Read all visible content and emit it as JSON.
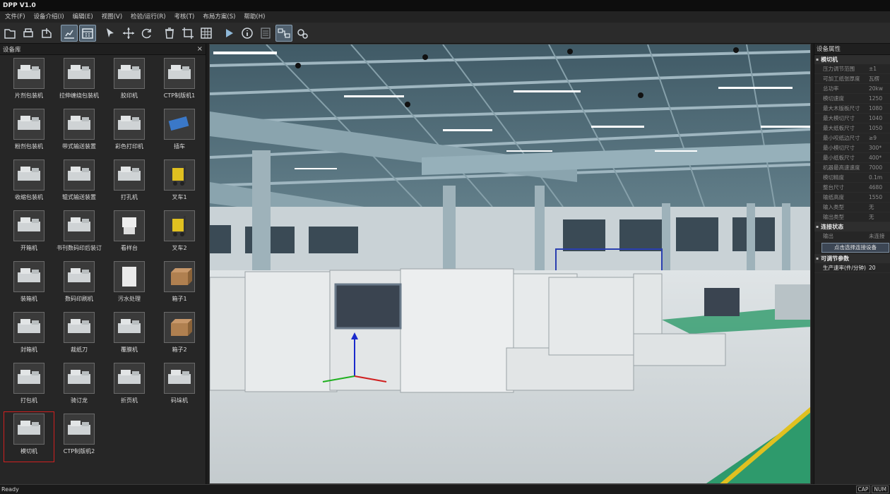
{
  "window": {
    "title": "DPP  V1.0"
  },
  "menu": [
    "文件(F)",
    "设备介绍(I)",
    "编辑(E)",
    "视图(V)",
    "检验/运行(R)",
    "考核(T)",
    "布局方案(S)",
    "帮助(H)"
  ],
  "toolbar": {
    "icons": [
      "open-icon",
      "print-icon",
      "export-icon",
      "chart-icon",
      "calendar-icon",
      "pointer-icon",
      "move-icon",
      "rotate-icon",
      "trash-icon",
      "crop-icon",
      "grid-icon",
      "play-icon",
      "info-icon",
      "list-icon",
      "network-icon",
      "gears-icon"
    ],
    "active": [
      "chart-icon",
      "calendar-icon",
      "network-icon"
    ]
  },
  "library": {
    "title": "设备库",
    "close": "×",
    "items": [
      {
        "label": "片剂包装机",
        "icon": "tablet-packer-icon"
      },
      {
        "label": "拉伸缠绕包装机",
        "icon": "stretch-wrapper-icon"
      },
      {
        "label": "胶印机",
        "icon": "offset-press-icon"
      },
      {
        "label": "CTP制版机1",
        "icon": "ctp-platesetter-icon"
      },
      {
        "label": "粉剂包装机",
        "icon": "powder-packer-icon"
      },
      {
        "label": "带式输送装置",
        "icon": "belt-conveyor-icon"
      },
      {
        "label": "彩色打印机",
        "icon": "color-printer-icon"
      },
      {
        "label": "插车",
        "icon": "cart-icon"
      },
      {
        "label": "收缩包装机",
        "icon": "shrink-wrapper-icon"
      },
      {
        "label": "辊式输送装置",
        "icon": "roller-conveyor-icon"
      },
      {
        "label": "打孔机",
        "icon": "punch-machine-icon"
      },
      {
        "label": "叉车1",
        "icon": "forklift-icon"
      },
      {
        "label": "开箱机",
        "icon": "case-erector-icon"
      },
      {
        "label": "书刊数码印后装订",
        "icon": "book-binder-icon"
      },
      {
        "label": "看样台",
        "icon": "proof-table-icon"
      },
      {
        "label": "叉车2",
        "icon": "forklift-icon"
      },
      {
        "label": "装箱机",
        "icon": "case-packer-icon"
      },
      {
        "label": "数码印刷机",
        "icon": "digital-press-icon"
      },
      {
        "label": "污水处理",
        "icon": "wastewater-icon"
      },
      {
        "label": "箱子1",
        "icon": "box-icon"
      },
      {
        "label": "封箱机",
        "icon": "case-sealer-icon"
      },
      {
        "label": "裁纸刀",
        "icon": "paper-cutter-icon"
      },
      {
        "label": "覆膜机",
        "icon": "laminator-icon"
      },
      {
        "label": "箱子2",
        "icon": "box-icon"
      },
      {
        "label": "打包机",
        "icon": "strapping-machine-icon"
      },
      {
        "label": "骑订龙",
        "icon": "saddle-stitcher-icon"
      },
      {
        "label": "折页机",
        "icon": "folder-icon"
      },
      {
        "label": "码垛机",
        "icon": "palletizer-icon"
      },
      {
        "label": "模切机",
        "icon": "die-cutter-icon",
        "selected": true
      },
      {
        "label": "CTP制版机2",
        "icon": "ctp-platesetter-icon"
      }
    ]
  },
  "properties": {
    "title": "设备属性",
    "sections": [
      {
        "name": "模切机",
        "rows": [
          {
            "k": "压力调节范围",
            "v": "±1"
          },
          {
            "k": "可加工纸张厚度",
            "v": "瓦楞"
          },
          {
            "k": "总功率",
            "v": "20kw"
          },
          {
            "k": "模切速度",
            "v": "1250"
          },
          {
            "k": "最大木版板尺寸",
            "v": "1080"
          },
          {
            "k": "最大模切尺寸",
            "v": "1040"
          },
          {
            "k": "最大纸板尺寸",
            "v": "1050"
          },
          {
            "k": "最小咬纸边尺寸",
            "v": "≥9"
          },
          {
            "k": "最小模切尺寸",
            "v": "300*"
          },
          {
            "k": "最小纸板尺寸",
            "v": "400*"
          },
          {
            "k": "机器最高速速度",
            "v": "7000"
          },
          {
            "k": "模切精度",
            "v": "0.1m"
          },
          {
            "k": "整台尺寸",
            "v": "4680"
          },
          {
            "k": "输纸高度",
            "v": "1550"
          },
          {
            "k": "输入类型",
            "v": "无"
          },
          {
            "k": "输出类型",
            "v": "无"
          }
        ]
      },
      {
        "name": "连接状态",
        "rows": [
          {
            "k": "输出",
            "v": "未连接"
          }
        ],
        "button": "点击选择连接设备"
      },
      {
        "name": "可调节参数",
        "rows": [
          {
            "k": "生产速率(件/分钟)",
            "v": "20",
            "bright": true
          }
        ]
      }
    ]
  },
  "status": {
    "text": "Ready",
    "caps": "CAP",
    "num": "NUM"
  }
}
